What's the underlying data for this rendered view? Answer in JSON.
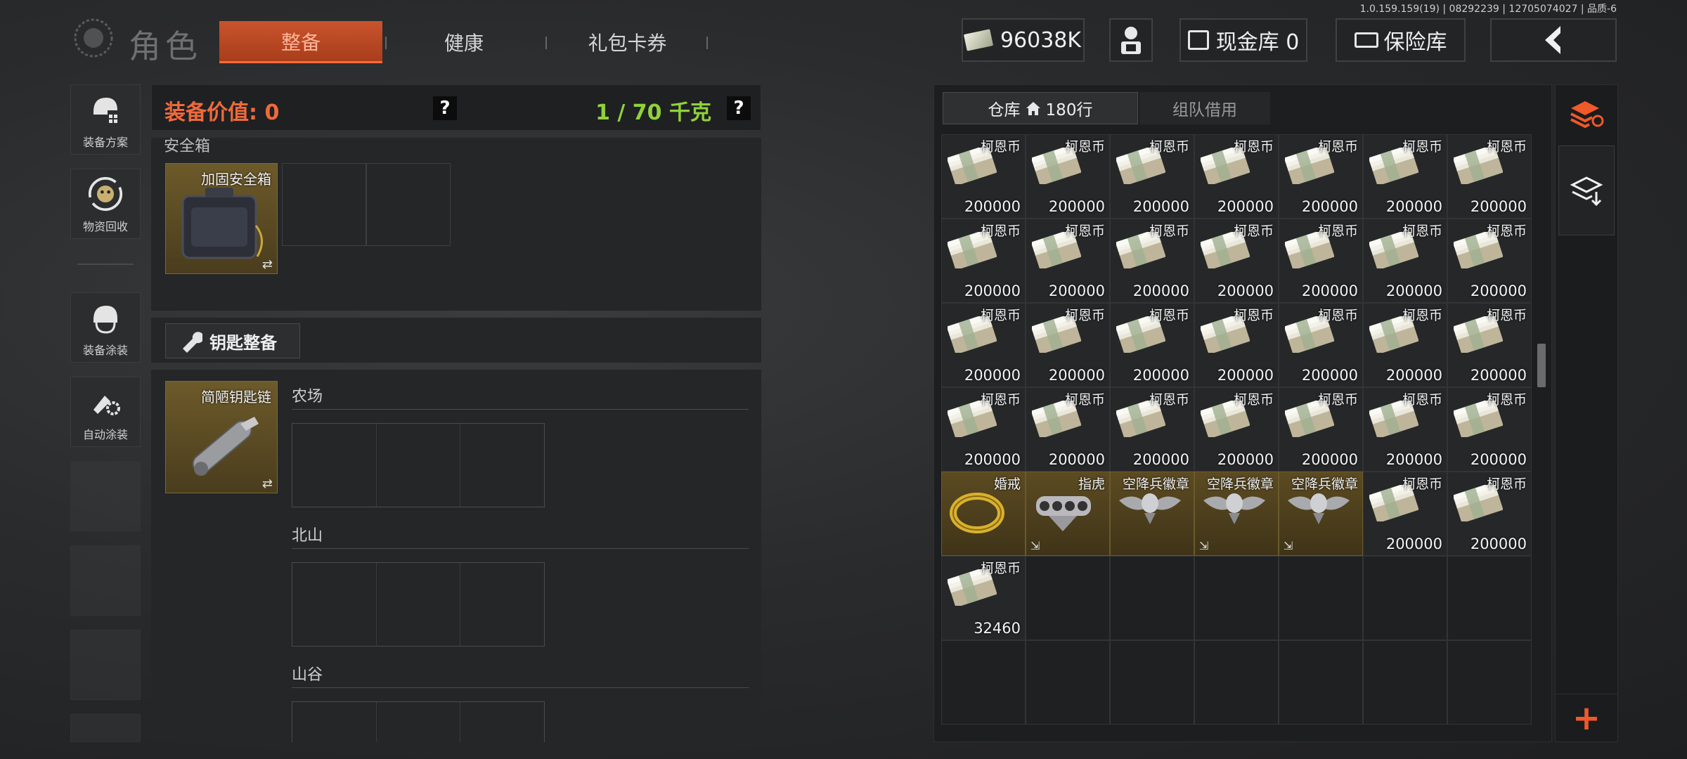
{
  "version_text": "1.0.159.159(19) | 08292239 | 12705074027 | 品质-6",
  "header": {
    "title": "角色",
    "tabs": [
      {
        "label": "整备",
        "active": true
      },
      {
        "label": "健康",
        "active": false
      },
      {
        "label": "礼包卡券",
        "active": false
      }
    ],
    "money": "96038K",
    "cash_vault": "现金库 0",
    "insurance": "保险库",
    "icons": {
      "agent": "agent-icon",
      "back": "back-arrow-icon",
      "money": "cash-stack-icon"
    }
  },
  "sidebar": {
    "items": [
      {
        "label": "装备方案",
        "icon": "helmet-grid-icon"
      },
      {
        "label": "物资回收",
        "icon": "recycle-mascot-icon"
      },
      {
        "label": "装备涂装",
        "icon": "helmet-paint-icon"
      },
      {
        "label": "自动涂装",
        "icon": "brush-gear-icon"
      }
    ]
  },
  "equipment": {
    "value_label": "装备价值: 0",
    "weight_label": "1 / 70 千克",
    "help": "?",
    "safe_box_title": "安全箱",
    "safe_box_item": "加固安全箱",
    "key_section_button": "钥匙整备",
    "key_item": "简陋钥匙链",
    "maps": [
      "农场",
      "北山",
      "山谷"
    ]
  },
  "warehouse": {
    "tabs": [
      {
        "label": "仓库",
        "suffix": "180行",
        "active": true
      },
      {
        "label": "组队借用",
        "active": false
      }
    ],
    "items": [
      {
        "name": "柯恩币",
        "value": "200000",
        "type": "cash"
      },
      {
        "name": "柯恩币",
        "value": "200000",
        "type": "cash"
      },
      {
        "name": "柯恩币",
        "value": "200000",
        "type": "cash"
      },
      {
        "name": "柯恩币",
        "value": "200000",
        "type": "cash"
      },
      {
        "name": "柯恩币",
        "value": "200000",
        "type": "cash"
      },
      {
        "name": "柯恩币",
        "value": "200000",
        "type": "cash"
      },
      {
        "name": "柯恩币",
        "value": "200000",
        "type": "cash"
      },
      {
        "name": "柯恩币",
        "value": "200000",
        "type": "cash"
      },
      {
        "name": "柯恩币",
        "value": "200000",
        "type": "cash"
      },
      {
        "name": "柯恩币",
        "value": "200000",
        "type": "cash"
      },
      {
        "name": "柯恩币",
        "value": "200000",
        "type": "cash"
      },
      {
        "name": "柯恩币",
        "value": "200000",
        "type": "cash"
      },
      {
        "name": "柯恩币",
        "value": "200000",
        "type": "cash"
      },
      {
        "name": "柯恩币",
        "value": "200000",
        "type": "cash"
      },
      {
        "name": "柯恩币",
        "value": "200000",
        "type": "cash"
      },
      {
        "name": "柯恩币",
        "value": "200000",
        "type": "cash"
      },
      {
        "name": "柯恩币",
        "value": "200000",
        "type": "cash"
      },
      {
        "name": "柯恩币",
        "value": "200000",
        "type": "cash"
      },
      {
        "name": "柯恩币",
        "value": "200000",
        "type": "cash"
      },
      {
        "name": "柯恩币",
        "value": "200000",
        "type": "cash"
      },
      {
        "name": "柯恩币",
        "value": "200000",
        "type": "cash"
      },
      {
        "name": "柯恩币",
        "value": "200000",
        "type": "cash"
      },
      {
        "name": "柯恩币",
        "value": "200000",
        "type": "cash"
      },
      {
        "name": "柯恩币",
        "value": "200000",
        "type": "cash"
      },
      {
        "name": "柯恩币",
        "value": "200000",
        "type": "cash"
      },
      {
        "name": "柯恩币",
        "value": "200000",
        "type": "cash"
      },
      {
        "name": "柯恩币",
        "value": "200000",
        "type": "cash"
      },
      {
        "name": "柯恩币",
        "value": "200000",
        "type": "cash"
      },
      {
        "name": "婚戒",
        "value": "",
        "type": "ring"
      },
      {
        "name": "指虎",
        "value": "",
        "type": "knuckles",
        "exit": true
      },
      {
        "name": "空降兵徽章",
        "value": "",
        "type": "badge"
      },
      {
        "name": "空降兵徽章",
        "value": "",
        "type": "badge",
        "exit": true
      },
      {
        "name": "空降兵徽章",
        "value": "",
        "type": "badge",
        "exit": true
      },
      {
        "name": "柯恩币",
        "value": "200000",
        "type": "cash"
      },
      {
        "name": "柯恩币",
        "value": "200000",
        "type": "cash"
      },
      {
        "name": "柯恩币",
        "value": "32460",
        "type": "cash"
      }
    ],
    "total_cells": 49
  },
  "right_column": {
    "sort_icon": "sort-stack-icon",
    "deposit_icon": "deposit-stack-icon",
    "add_label": "+"
  }
}
